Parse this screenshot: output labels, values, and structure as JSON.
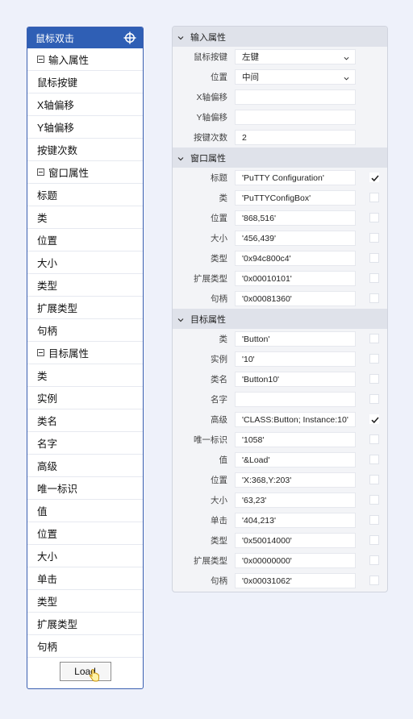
{
  "left": {
    "title": "鼠标双击",
    "items": [
      {
        "label": "输入属性",
        "group": true
      },
      {
        "label": "鼠标按键"
      },
      {
        "label": "X轴偏移"
      },
      {
        "label": "Y轴偏移"
      },
      {
        "label": "按键次数"
      },
      {
        "label": "窗口属性",
        "group": true
      },
      {
        "label": "标题"
      },
      {
        "label": "类"
      },
      {
        "label": "位置"
      },
      {
        "label": "大小"
      },
      {
        "label": "类型"
      },
      {
        "label": "扩展类型"
      },
      {
        "label": "句柄"
      },
      {
        "label": "目标属性",
        "group": true
      },
      {
        "label": "类"
      },
      {
        "label": "实例"
      },
      {
        "label": "类名"
      },
      {
        "label": "名字"
      },
      {
        "label": "高级"
      },
      {
        "label": "唯一标识"
      },
      {
        "label": "值"
      },
      {
        "label": "位置"
      },
      {
        "label": "大小"
      },
      {
        "label": "单击"
      },
      {
        "label": "类型"
      },
      {
        "label": "扩展类型"
      },
      {
        "label": "句柄"
      }
    ],
    "load_label": "Load"
  },
  "right": {
    "sections": [
      {
        "title": "输入属性",
        "rows": [
          {
            "label": "鼠标按键",
            "value": "左键",
            "dropdown": true
          },
          {
            "label": "位置",
            "value": "中间",
            "dropdown": true
          },
          {
            "label": "X轴偏移",
            "value": ""
          },
          {
            "label": "Y轴偏移",
            "value": ""
          },
          {
            "label": "按键次数",
            "value": "2"
          }
        ]
      },
      {
        "title": "窗口属性",
        "rows": [
          {
            "label": "标题",
            "value": "'PuTTY Configuration'",
            "checkbox": true,
            "checked": true
          },
          {
            "label": "类",
            "value": "'PuTTYConfigBox'",
            "checkbox": true,
            "checked": false
          },
          {
            "label": "位置",
            "value": "'868,516'",
            "checkbox": true,
            "checked": false
          },
          {
            "label": "大小",
            "value": "'456,439'",
            "checkbox": true,
            "checked": false
          },
          {
            "label": "类型",
            "value": "'0x94c800c4'",
            "checkbox": true,
            "checked": false
          },
          {
            "label": "扩展类型",
            "value": "'0x00010101'",
            "checkbox": true,
            "checked": false
          },
          {
            "label": "句柄",
            "value": "'0x00081360'",
            "checkbox": true,
            "checked": false
          }
        ]
      },
      {
        "title": "目标属性",
        "rows": [
          {
            "label": "类",
            "value": "'Button'",
            "checkbox": true,
            "checked": false
          },
          {
            "label": "实例",
            "value": "'10'",
            "checkbox": true,
            "checked": false
          },
          {
            "label": "类名",
            "value": "'Button10'",
            "checkbox": true,
            "checked": false
          },
          {
            "label": "名字",
            "value": "",
            "checkbox": true,
            "checked": false
          },
          {
            "label": "高级",
            "value": "'CLASS:Button; Instance:10'",
            "checkbox": true,
            "checked": true
          },
          {
            "label": "唯一标识",
            "value": "'1058'",
            "checkbox": true,
            "checked": false
          },
          {
            "label": "值",
            "value": "'&Load'",
            "checkbox": true,
            "checked": false
          },
          {
            "label": "位置",
            "value": "'X:368,Y:203'",
            "checkbox": true,
            "checked": false
          },
          {
            "label": "大小",
            "value": "'63,23'",
            "checkbox": true,
            "checked": false
          },
          {
            "label": "单击",
            "value": "'404,213'",
            "checkbox": true,
            "checked": false
          },
          {
            "label": "类型",
            "value": "'0x50014000'",
            "checkbox": true,
            "checked": false
          },
          {
            "label": "扩展类型",
            "value": "'0x00000000'",
            "checkbox": true,
            "checked": false
          },
          {
            "label": "句柄",
            "value": "'0x00031062'",
            "checkbox": true,
            "checked": false
          }
        ]
      }
    ]
  },
  "icons": {
    "header": "crosshair-icon",
    "group_toggle": "collapse-box-icon",
    "section_toggle": "chevron-down-icon",
    "dropdown": "chevron-down-icon",
    "check": "checkmark-icon",
    "cursor": "hand-cursor-icon"
  },
  "colors": {
    "header_bg": "#2f5fb5",
    "page_bg": "#eef1fa",
    "section_bg": "#dfe2ea"
  }
}
